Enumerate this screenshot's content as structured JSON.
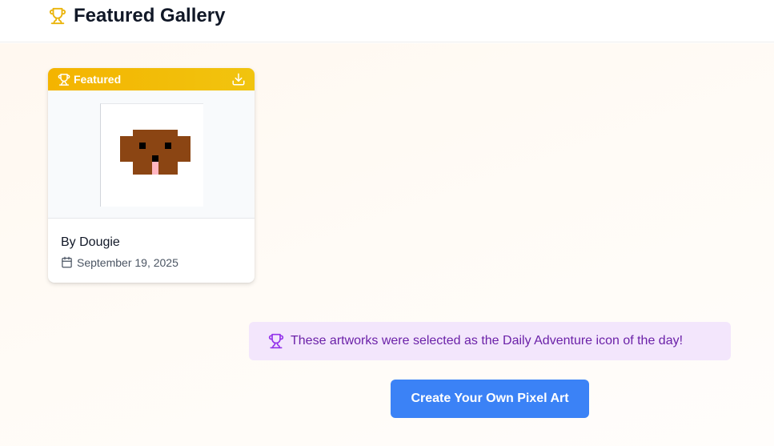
{
  "header": {
    "title": "Featured Gallery",
    "icon": "trophy-icon",
    "icon_color": "#eab308"
  },
  "gallery": {
    "cards": [
      {
        "badge_label": "Featured",
        "badge_icon": "trophy-icon",
        "action_icon": "download-icon",
        "author": "By Dougie",
        "date_icon": "calendar-icon",
        "date": "September 19, 2025",
        "artwork_colors": {
          "fur": "#8b4513",
          "eyes": "#000000",
          "nose": "#000000",
          "tongue": "#ffb6c1",
          "background": "#ffffff"
        }
      }
    ]
  },
  "notice": {
    "icon": "trophy-icon",
    "text": "These artworks were selected as the Daily Adventure icon of the day!"
  },
  "cta": {
    "label": "Create Your Own Pixel Art"
  },
  "colors": {
    "badge": "#f4b400",
    "notice_background": "#f3e6fc",
    "notice_text": "#6b21a8",
    "primary_button": "#3b82f6"
  }
}
